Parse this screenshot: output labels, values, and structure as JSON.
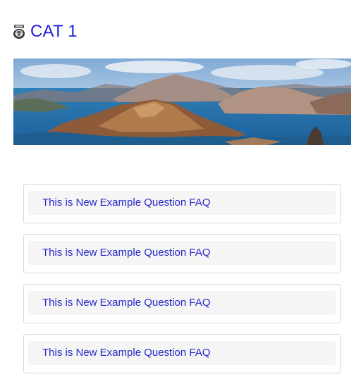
{
  "category": {
    "title": "CAT 1",
    "icon": "cat-badge-icon",
    "title_color": "#1f1fdc"
  },
  "banner": {
    "image": "landscape-banner-image"
  },
  "faq": {
    "items": [
      {
        "question": "This is New Example Question FAQ"
      },
      {
        "question": "This is New Example Question FAQ"
      },
      {
        "question": "This is New Example Question FAQ"
      },
      {
        "question": "This is New Example Question FAQ"
      }
    ],
    "question_color": "#2727c8",
    "question_bg": "#f5f5f5"
  }
}
